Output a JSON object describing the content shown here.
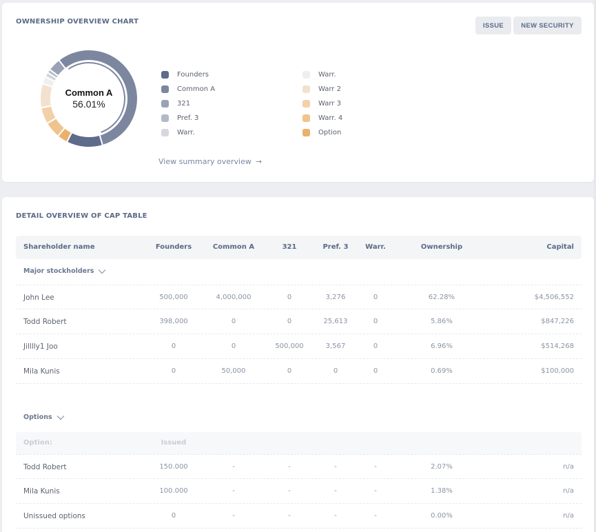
{
  "chart_card": {
    "title": "OWNERSHIP OVERVIEW CHART",
    "buttons": {
      "issue": "ISSUE",
      "new_security": "NEW SECURITY"
    },
    "center": {
      "label": "Common A",
      "value": "56.01%"
    },
    "summary_link": "View summary overview",
    "summary_arrow": "→"
  },
  "chart_data": {
    "type": "pie",
    "variant": "donut",
    "title": "OWNERSHIP OVERVIEW CHART",
    "highlighted": "Common A",
    "legend_position": "right",
    "series": [
      {
        "name": "Common A",
        "value": 56.01,
        "color": "#7c879f"
      },
      {
        "name": "Founders",
        "value": 12.0,
        "color": "#5e6c8a"
      },
      {
        "name": "Option",
        "value": 3.5,
        "color": "#ebb16b"
      },
      {
        "name": "Warr. 4",
        "value": 5.5,
        "color": "#f0c48f"
      },
      {
        "name": "Warr 3",
        "value": 5.5,
        "color": "#f2d0aa"
      },
      {
        "name": "Warr 2",
        "value": 8.0,
        "color": "#f3e1cf"
      },
      {
        "name": "Warr.",
        "value": 2.5,
        "color": "#eeeff1"
      },
      {
        "name": "Warr.",
        "value": 1.5,
        "color": "#d1d4db"
      },
      {
        "name": "Pref. 3",
        "value": 1.2,
        "color": "#b3bac7"
      },
      {
        "name": "321",
        "value": 4.29,
        "color": "#9aa2b4"
      }
    ],
    "legend": [
      {
        "label": "Founders",
        "color": "#5e6c8a"
      },
      {
        "label": "Common A",
        "color": "#7c879f"
      },
      {
        "label": "321",
        "color": "#9aa2b4"
      },
      {
        "label": "Pref. 3",
        "color": "#b3bac7"
      },
      {
        "label": "Warr.",
        "color": "#d6d8de"
      },
      {
        "label": "Warr.",
        "color": "#eeeff1"
      },
      {
        "label": "Warr 2",
        "color": "#f3e1cf"
      },
      {
        "label": "Warr 3",
        "color": "#f2d0aa"
      },
      {
        "label": "Warr. 4",
        "color": "#f0c48f"
      },
      {
        "label": "Option",
        "color": "#ebb16b"
      }
    ]
  },
  "table_card": {
    "title": "DETAIL OVERVIEW OF CAP TABLE",
    "columns": [
      "Shareholder name",
      "Founders",
      "Common A",
      "321",
      "Pref. 3",
      "Warr.",
      "Ownership",
      "Capital"
    ],
    "groups": [
      {
        "label": "Major stockholders",
        "rows": [
          [
            "John Lee",
            "500,000",
            "4,000,000",
            "0",
            "3,276",
            "0",
            "62.28%",
            "$4,506,552"
          ],
          [
            "Todd Robert",
            "398,000",
            "0",
            "0",
            "25,613",
            "0",
            "5.86%",
            "$847,226"
          ],
          [
            "Jilllly1 Joo",
            "0",
            "0",
            "500,000",
            "3,567",
            "0",
            "6.96%",
            "$514,268"
          ],
          [
            "Mila Kunis",
            "0",
            "50,000",
            "0",
            "0",
            "0",
            "0.69%",
            "$100,000"
          ]
        ]
      },
      {
        "label": "Options",
        "subheader": [
          "Option:",
          "Issued"
        ],
        "rows": [
          [
            "Todd Robert",
            "150.000",
            "-",
            "-",
            "-",
            "-",
            "2.07%",
            "n/a"
          ],
          [
            "Mila Kunis",
            "100.000",
            "-",
            "-",
            "-",
            "-",
            "1.38%",
            "n/a"
          ],
          [
            "Unissued options",
            "0",
            "-",
            "-",
            "-",
            "-",
            "0.00%",
            "n/a"
          ]
        ]
      }
    ]
  }
}
